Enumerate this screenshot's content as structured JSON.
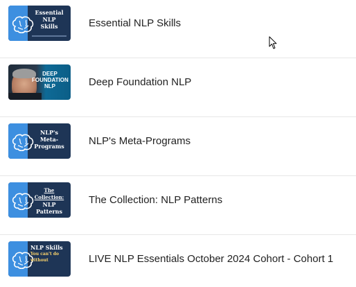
{
  "courses": [
    {
      "title": "Essential NLP Skills",
      "thumb_lines": [
        "Essential",
        "NLP",
        "Skills"
      ]
    },
    {
      "title": "Deep Foundation NLP",
      "thumb_lines": [
        "DEEP",
        "FOUNDATION",
        "NLP"
      ]
    },
    {
      "title": "NLP's Meta-Programs",
      "thumb_lines": [
        "NLP's",
        "Meta-",
        "Programs"
      ]
    },
    {
      "title": "The Collection: NLP Patterns",
      "thumb_lines": [
        "The Collection:",
        "NLP",
        "Patterns"
      ]
    },
    {
      "title": "LIVE NLP Essentials October 2024 Cohort - Cohort 1",
      "thumb_lines": [
        "NLP Skills",
        "You can't do",
        "without"
      ]
    }
  ],
  "colors": {
    "thumb_dark": "#1e3556",
    "thumb_accent": "#3d8fe0",
    "divider": "#e6e6e6",
    "text": "#222222"
  }
}
